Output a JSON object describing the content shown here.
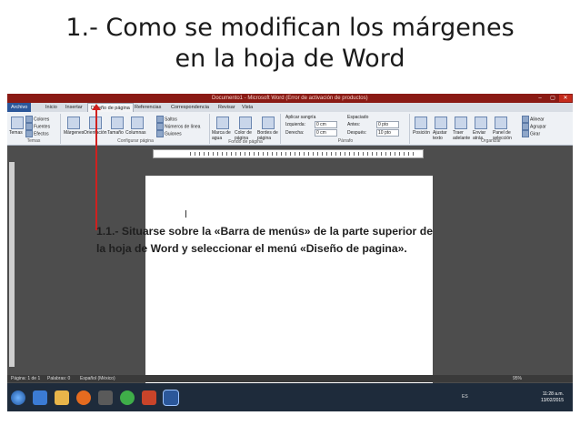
{
  "slide": {
    "title_line1": "1.- Como se modifican los márgenes",
    "title_line2": "en la hoja de Word"
  },
  "window": {
    "title": "Documento1 - Microsoft Word (Error de activación de productos)",
    "controls": [
      "–",
      "▢",
      "✕"
    ]
  },
  "tabs": [
    {
      "label": "Archivo"
    },
    {
      "label": "Inicio"
    },
    {
      "label": "Insertar"
    },
    {
      "label": "Diseño de página"
    },
    {
      "label": "Referencias"
    },
    {
      "label": "Correspondencia"
    },
    {
      "label": "Revisar"
    },
    {
      "label": "Vista"
    }
  ],
  "ribbon": {
    "temas": {
      "colores": "Colores",
      "fuentes": "Fuentes",
      "efectos": "Efectos",
      "temas": "Temas",
      "label": "Temas"
    },
    "config": {
      "margenes": "Márgenes",
      "orientacion": "Orientación",
      "tamano": "Tamaño",
      "columnas": "Columnas",
      "saltos": "Saltos",
      "numeros": "Números de línea",
      "guiones": "Guiones",
      "label": "Configurar página"
    },
    "fondo": {
      "marca": "Marca de agua",
      "color": "Color de página",
      "bordes": "Bordes de página",
      "label": "Fondo de página"
    },
    "parrafo": {
      "aplicar": "Aplicar sangría",
      "izquierda": "Izquierda:",
      "izq_val": "0 cm",
      "derecha": "Derecha:",
      "der_val": "0 cm",
      "espaciado": "Espaciado",
      "antes": "Antes:",
      "antes_val": "0 pto",
      "despues": "Después:",
      "despues_val": "10 pto",
      "label": "Párrafo"
    },
    "organizar": {
      "posicion": "Posición",
      "ajustar": "Ajustar texto",
      "traer": "Traer adelante",
      "enviar": "Enviar atrás",
      "panel": "Panel de selección",
      "alinear": "Alinear",
      "agrupar": "Agrupar",
      "girar": "Girar",
      "label": "Organizar"
    }
  },
  "statusbar": {
    "pagina": "Página: 1 de 1",
    "palabras": "Palabras: 0",
    "idioma": "Español (México)",
    "zoom": "95%"
  },
  "taskbar": {
    "time": "11:28 a.m.",
    "date": "13/02/2015",
    "lang": "ES"
  },
  "callout": {
    "text": "1.1.- Situarse sobre la «Barra de menús» de la parte superior de la hoja de Word y seleccionar el menú «Diseño de pagina»."
  },
  "colors": {
    "title_bar": "#8a1a14",
    "annotation_arrow": "#d0201f",
    "taskbar": "#1e2b3b"
  }
}
